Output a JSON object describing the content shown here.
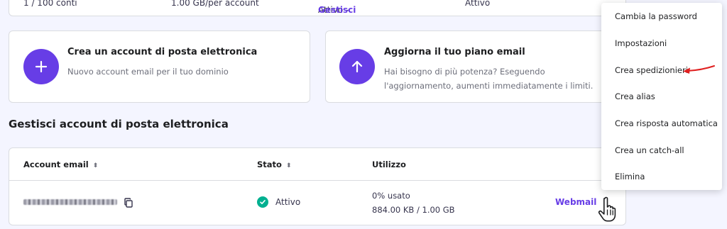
{
  "top_strip": {
    "accounts": "1 / 100 conti",
    "storage": "1.00 GB/per account",
    "status_prefix": "Attivo - ",
    "status_link": "Gestisci",
    "status_extra": "Attivo"
  },
  "cards": [
    {
      "icon": "plus-icon",
      "title": "Crea un account di posta elettronica",
      "description": "Nuovo account email per il tuo dominio"
    },
    {
      "icon": "arrow-up-icon",
      "title": "Aggiorna il tuo piano email",
      "description": "Hai bisogno di più potenza? Eseguendo l'aggiornamento, aumenti immediatamente i limiti."
    }
  ],
  "section_title": "Gestisci account di posta elettronica",
  "table": {
    "headers": {
      "email": "Account email",
      "status": "Stato",
      "usage": "Utilizzo"
    },
    "rows": [
      {
        "status": "Attivo",
        "usage_percent": "0% usato",
        "usage_value": "884.00 KB / 1.00 GB",
        "action": "Webmail"
      }
    ]
  },
  "menu": {
    "items": [
      "Cambia la password",
      "Impostazioni",
      "Crea spedizionieri",
      "Crea alias",
      "Crea risposta automatica",
      "Crea un catch-all",
      "Elimina"
    ],
    "highlighted_item": "Crea spedizionieri"
  },
  "colors": {
    "accent": "#673de6",
    "success": "#00b090",
    "annotation_arrow": "#e02020",
    "page_background": "#f4f5ff"
  }
}
